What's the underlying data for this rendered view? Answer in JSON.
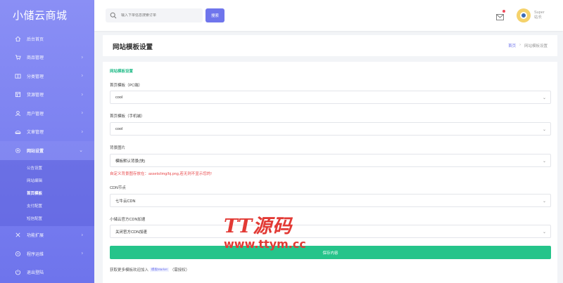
{
  "app": {
    "brand": "小储云商城"
  },
  "sidebar": {
    "items": [
      {
        "label": "后台首页",
        "icon": "home-icon",
        "has_children": false
      },
      {
        "label": "商品管理",
        "icon": "cart-icon",
        "has_children": true
      },
      {
        "label": "分类管理",
        "icon": "category-icon",
        "has_children": true
      },
      {
        "label": "货源管理",
        "icon": "supply-icon",
        "has_children": true
      },
      {
        "label": "用户管理",
        "icon": "user-icon",
        "has_children": true
      },
      {
        "label": "文章管理",
        "icon": "article-icon",
        "has_children": true
      },
      {
        "label": "网站设置",
        "icon": "settings-icon",
        "has_children": true,
        "open": true
      },
      {
        "label": "功能扩展",
        "icon": "extension-icon",
        "has_children": true
      },
      {
        "label": "程序运维",
        "icon": "maintenance-icon",
        "has_children": true
      },
      {
        "label": "退出登陆",
        "icon": "logout-icon",
        "has_children": false
      }
    ],
    "subitems": [
      {
        "label": "公告设置"
      },
      {
        "label": "网站编辑"
      },
      {
        "label": "首页模板",
        "active": true
      },
      {
        "label": "支付配置"
      },
      {
        "label": "短信配置"
      }
    ]
  },
  "topbar": {
    "search_placeholder": "输入下单信息搜索订单",
    "search_button": "搜索",
    "user_name": "Super",
    "user_role": "站长"
  },
  "page": {
    "title": "网站模板设置",
    "breadcrumb_home": "首页",
    "breadcrumb_sep": "›",
    "breadcrumb_current": "网站模板设置"
  },
  "form": {
    "section_title": "网站模板设置",
    "pc_template_label": "首页模板（PC端）",
    "pc_template_value": "cool",
    "mobile_template_label": "首页模板（手机端）",
    "mobile_template_value": "cool",
    "background_label": "背景图片",
    "background_value": "模板默认背景(快)",
    "background_hint": "自定义背景图存放在：assets/img/bj.png,若无则不显示您的!",
    "cdn_label": "CDN节点",
    "cdn_value": "七牛云CDN",
    "official_cdn_label": "小储云官方CDN加速",
    "official_cdn_value": "关闭官方CDN加速",
    "submit_label": "保存内容",
    "footer_prefix": "获取更多模板欢迎加入",
    "footer_tag": "模板Market",
    "footer_suffix": "（需授权）"
  },
  "watermark": {
    "line1": "TT源码",
    "line2": "www.ttym.cc"
  },
  "colors": {
    "sidebar": "#7b80f0",
    "accent": "#6f75ec",
    "success": "#25c48a",
    "danger": "#e8494b",
    "watermark": "#e23a35"
  }
}
